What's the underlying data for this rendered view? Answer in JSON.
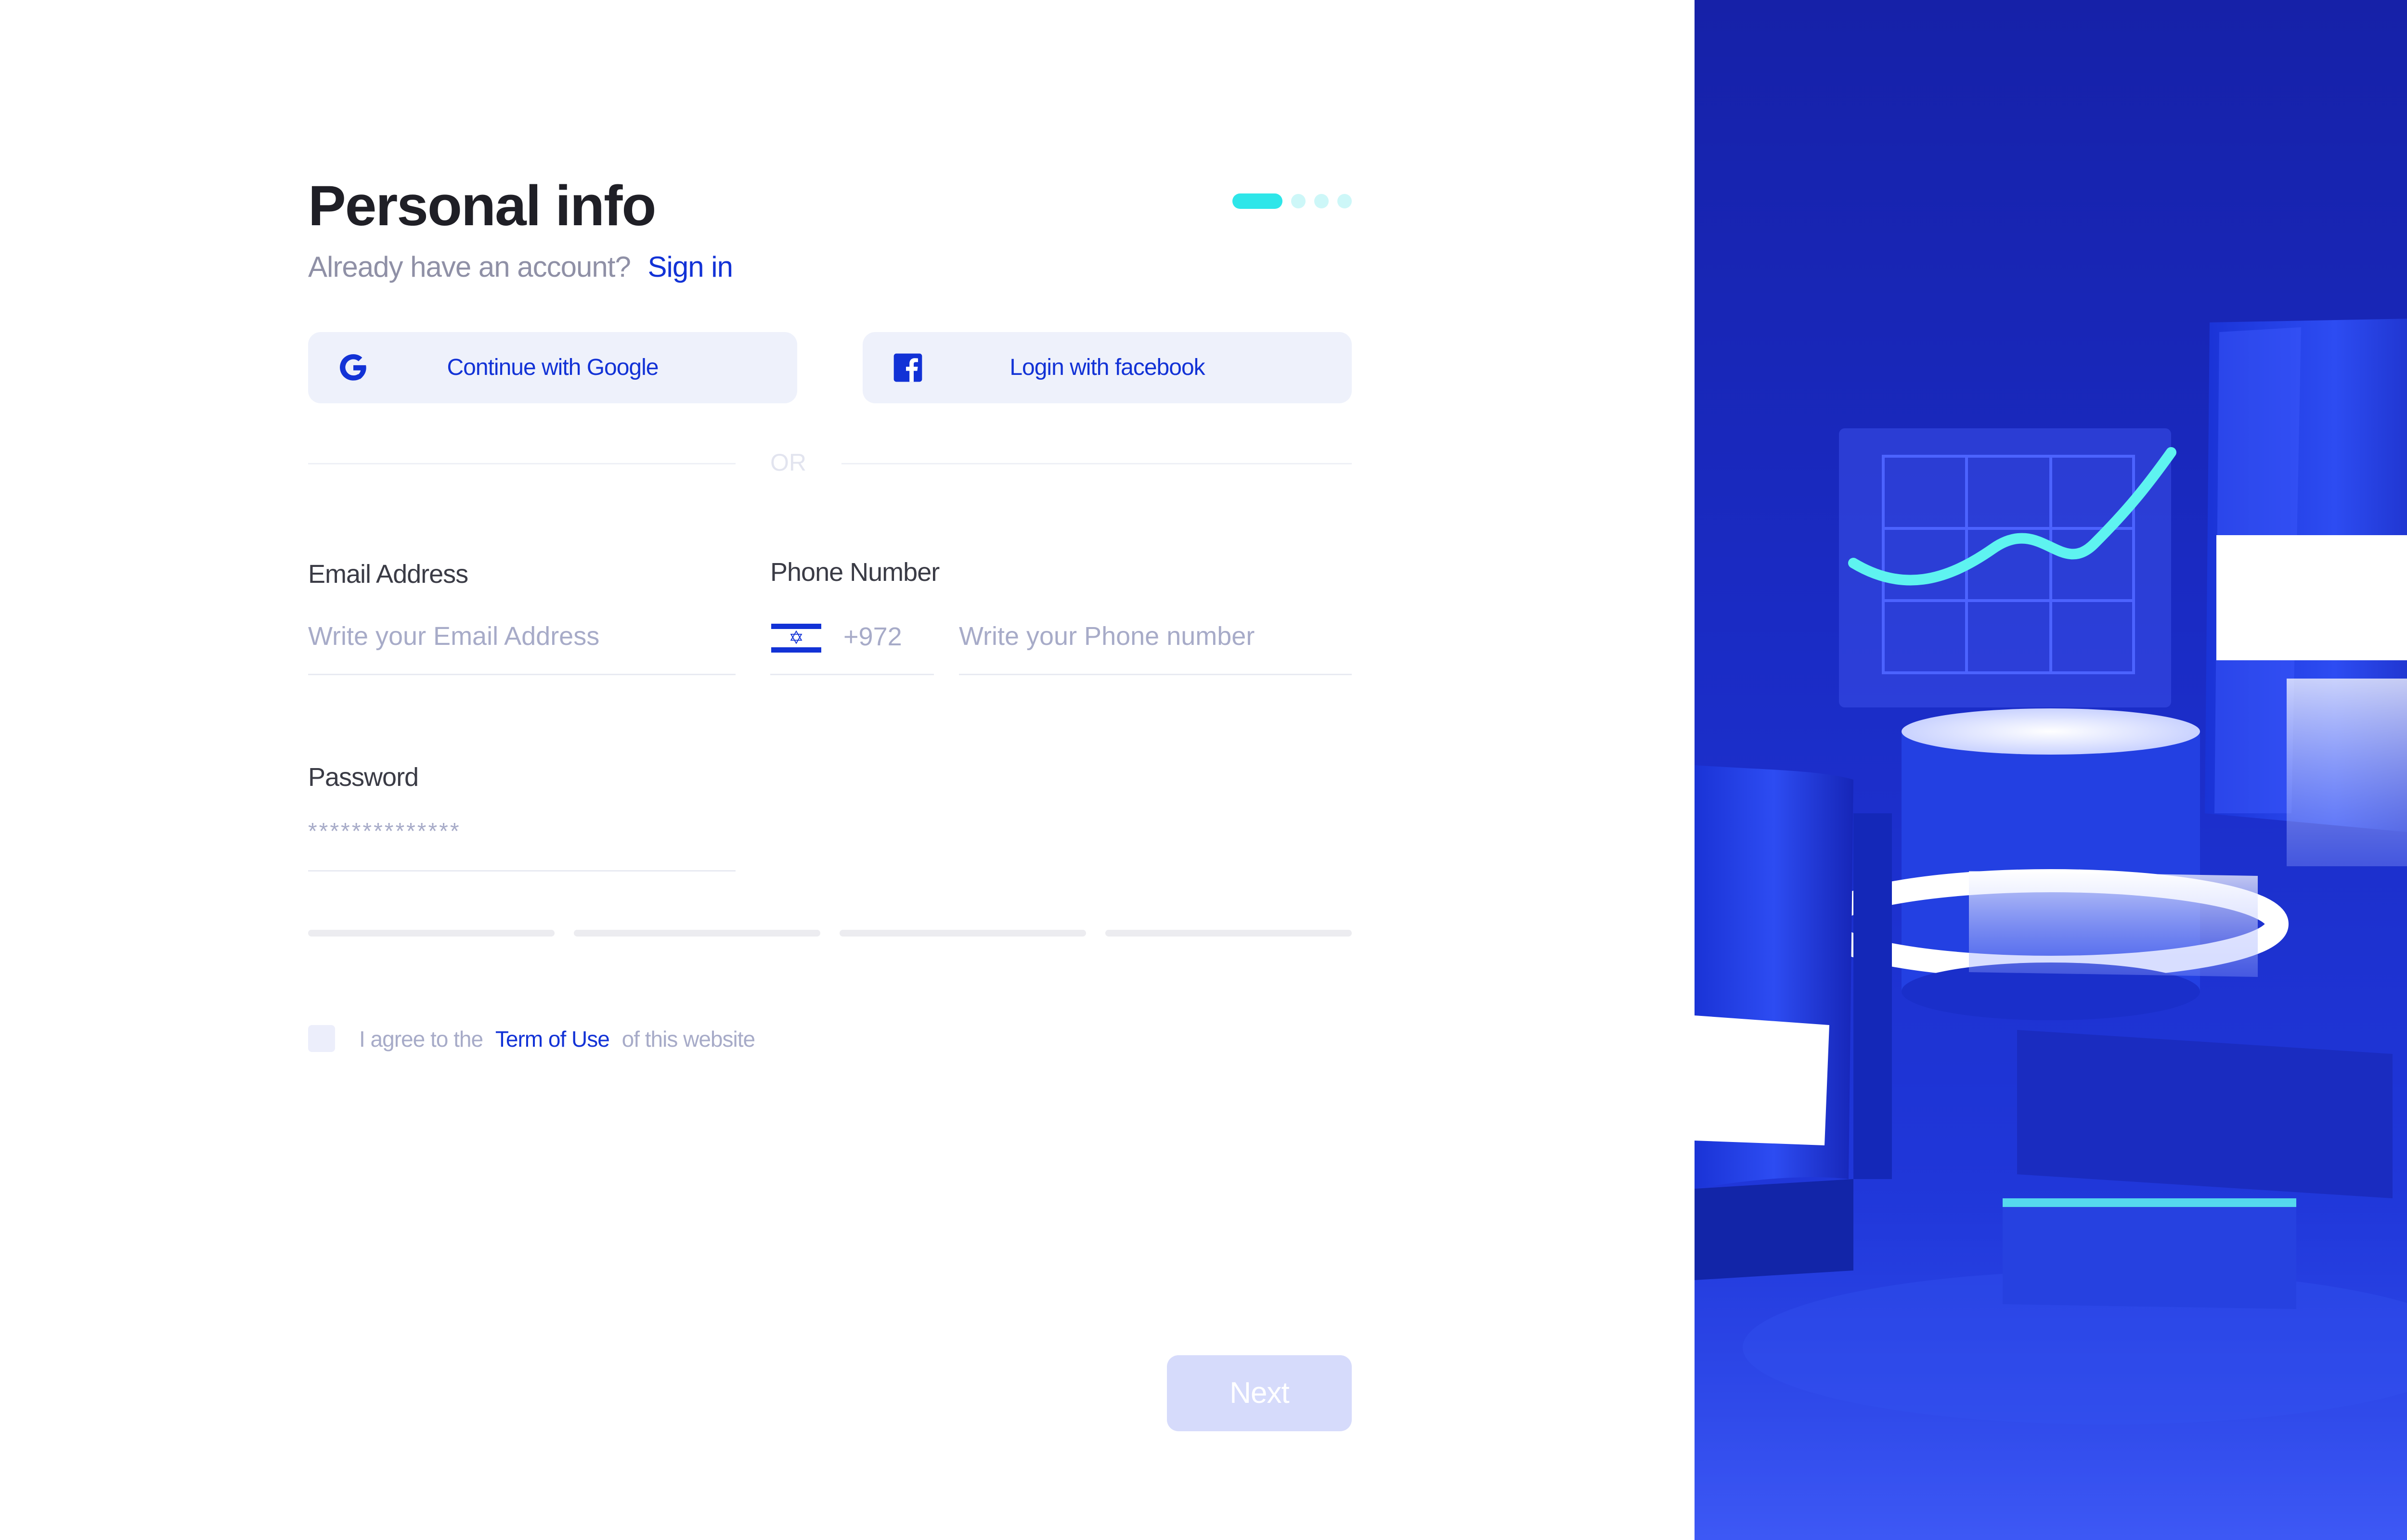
{
  "header": {
    "title": "Personal info",
    "subtitle_text": "Already have an account?",
    "signin_link": "Sign in",
    "step_current": 1,
    "step_total": 4
  },
  "social": {
    "google_label": "Continue with Google",
    "facebook_label": "Login with facebook"
  },
  "divider_text": "OR",
  "form": {
    "email": {
      "label": "Email Address",
      "placeholder": "Write your Email Address"
    },
    "phone": {
      "label": "Phone Number",
      "country_code": "+972",
      "placeholder": "Write your Phone number"
    },
    "password": {
      "label": "Password",
      "value": "**************"
    },
    "password_strength_segments": 4
  },
  "agreement": {
    "prefix": "I agree to the",
    "link": "Term of Use",
    "suffix": "of this website"
  },
  "next_button": "Next",
  "colors": {
    "accent": "#1232d6",
    "progress": "#2ee6e9",
    "hero_background": "#1a2bc4",
    "disabled_button": "#d6dbfb"
  },
  "icons": [
    "google-icon",
    "facebook-icon",
    "israel-flag-icon",
    "checkbox"
  ]
}
